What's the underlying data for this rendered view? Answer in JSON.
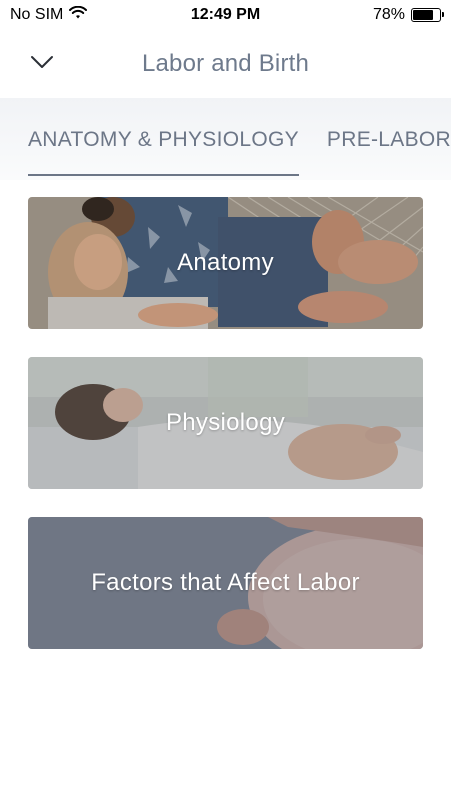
{
  "status": {
    "carrier": "No SIM",
    "time": "12:49 PM",
    "battery": "78%",
    "battery_level": 0.78
  },
  "nav": {
    "title": "Labor and Birth",
    "back_icon": "chevron-down-icon"
  },
  "tabs": [
    {
      "label": "ANATOMY & PHYSIOLOGY",
      "active": true
    },
    {
      "label": "PRE-LABOR",
      "active": false
    }
  ],
  "cards": [
    {
      "label": "Anatomy"
    },
    {
      "label": "Physiology"
    },
    {
      "label": "Factors that Affect Labor"
    }
  ]
}
